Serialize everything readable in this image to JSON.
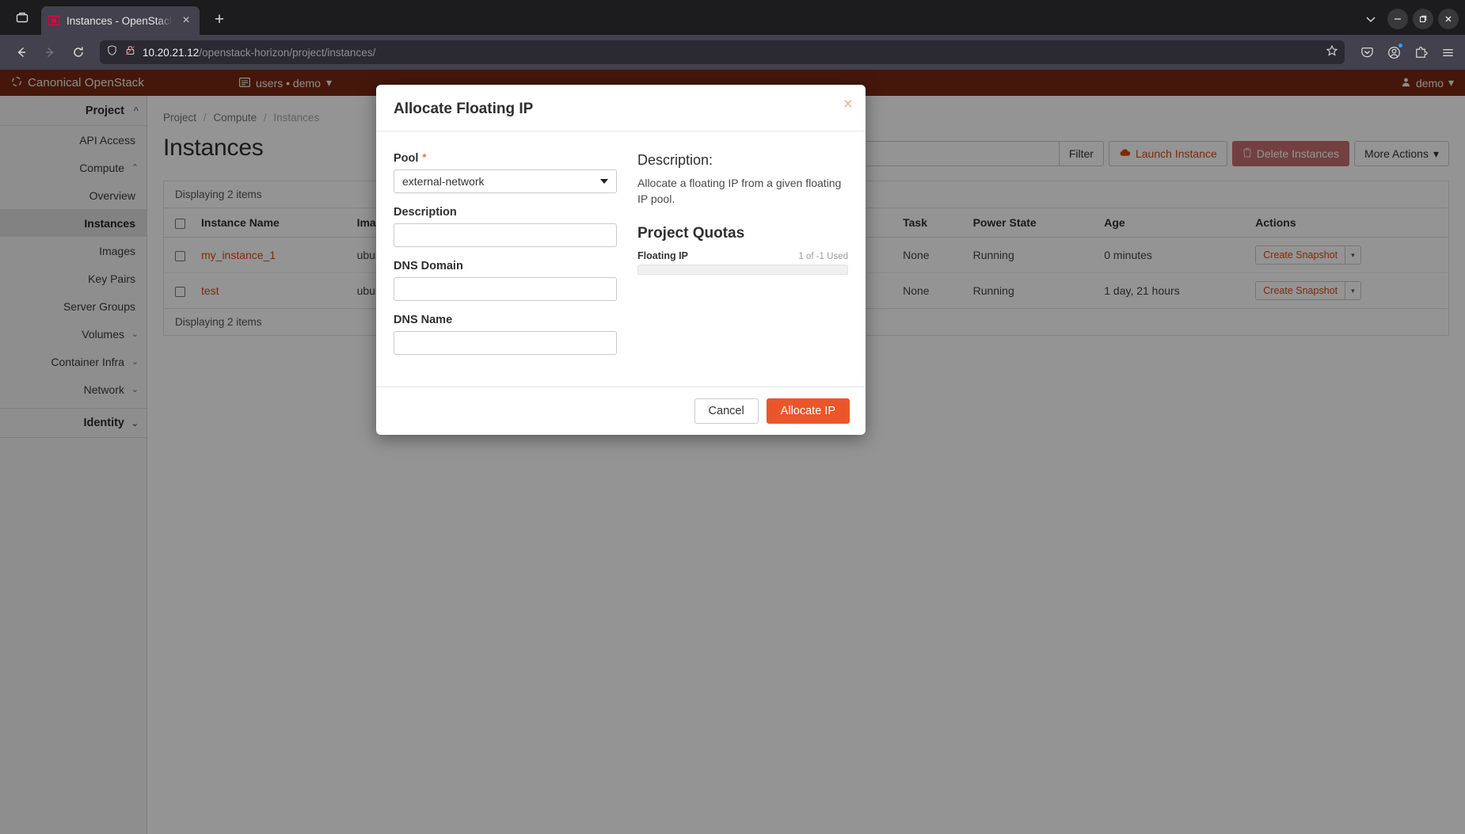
{
  "browser": {
    "tab": {
      "title": "Instances - OpenStack Da",
      "close_label": "×",
      "favicon": "openstack-favicon"
    },
    "new_tab_label": "+",
    "window_controls": {
      "minimize": "—",
      "maximize": "❐",
      "close": "×",
      "list_all_tabs": "⌄"
    },
    "url": {
      "host": "10.20.21.12",
      "path": "/openstack-horizon/project/instances/"
    },
    "nav": {
      "back": "←",
      "forward": "→",
      "reload": "⟳"
    }
  },
  "os_header": {
    "brand": "Canonical OpenStack",
    "context": "users • demo",
    "user": "demo"
  },
  "sidebar": {
    "project_group": "Project",
    "identity_group": "Identity",
    "items": [
      {
        "label": "API Access",
        "caret": "",
        "active": false
      },
      {
        "label": "Compute",
        "caret": "⌃",
        "active": false
      },
      {
        "label": "Overview",
        "caret": "",
        "active": false
      },
      {
        "label": "Instances",
        "caret": "",
        "active": true
      },
      {
        "label": "Images",
        "caret": "",
        "active": false
      },
      {
        "label": "Key Pairs",
        "caret": "",
        "active": false
      },
      {
        "label": "Server Groups",
        "caret": "",
        "active": false
      },
      {
        "label": "Volumes",
        "caret": "⌄",
        "active": false
      },
      {
        "label": "Container Infra",
        "caret": "⌄",
        "active": false
      },
      {
        "label": "Network",
        "caret": "⌄",
        "active": false
      }
    ]
  },
  "breadcrumb": {
    "root": "Project",
    "section": "Compute",
    "current": "Instances"
  },
  "main": {
    "title": "Instances",
    "search_placeholder": "",
    "filter_label": "Filter",
    "launch_label": "Launch Instance",
    "delete_label": "Delete Instances",
    "more_label": "More Actions",
    "count_top": "Displaying 2 items",
    "count_bottom": "Displaying 2 items",
    "columns": [
      "Instance Name",
      "Image Name",
      "Task",
      "Power State",
      "Age",
      "Actions"
    ],
    "rows": [
      {
        "name": "my_instance_1",
        "image": "ubuntu",
        "task": "None",
        "power": "Running",
        "age": "0 minutes",
        "action": "Create Snapshot"
      },
      {
        "name": "test",
        "image": "ubuntu",
        "task": "None",
        "power": "Running",
        "age": "1 day, 21 hours",
        "action": "Create Snapshot"
      }
    ]
  },
  "modal": {
    "title": "Allocate Floating IP",
    "close_label": "×",
    "pool_label": "Pool",
    "pool_required": "*",
    "pool_value": "external-network",
    "description_label": "Description",
    "description_value": "",
    "dns_domain_label": "DNS Domain",
    "dns_domain_value": "",
    "dns_name_label": "DNS Name",
    "dns_name_value": "",
    "info_heading": "Description:",
    "info_text": "Allocate a floating IP from a given floating IP pool.",
    "quota_heading": "Project Quotas",
    "quota_name": "Floating IP",
    "quota_used": "1 of -1 Used",
    "cancel_label": "Cancel",
    "submit_label": "Allocate IP"
  },
  "colors": {
    "brand_orange": "#dd4814",
    "header_maroon": "#772912",
    "primary_button": "#ea562a"
  }
}
